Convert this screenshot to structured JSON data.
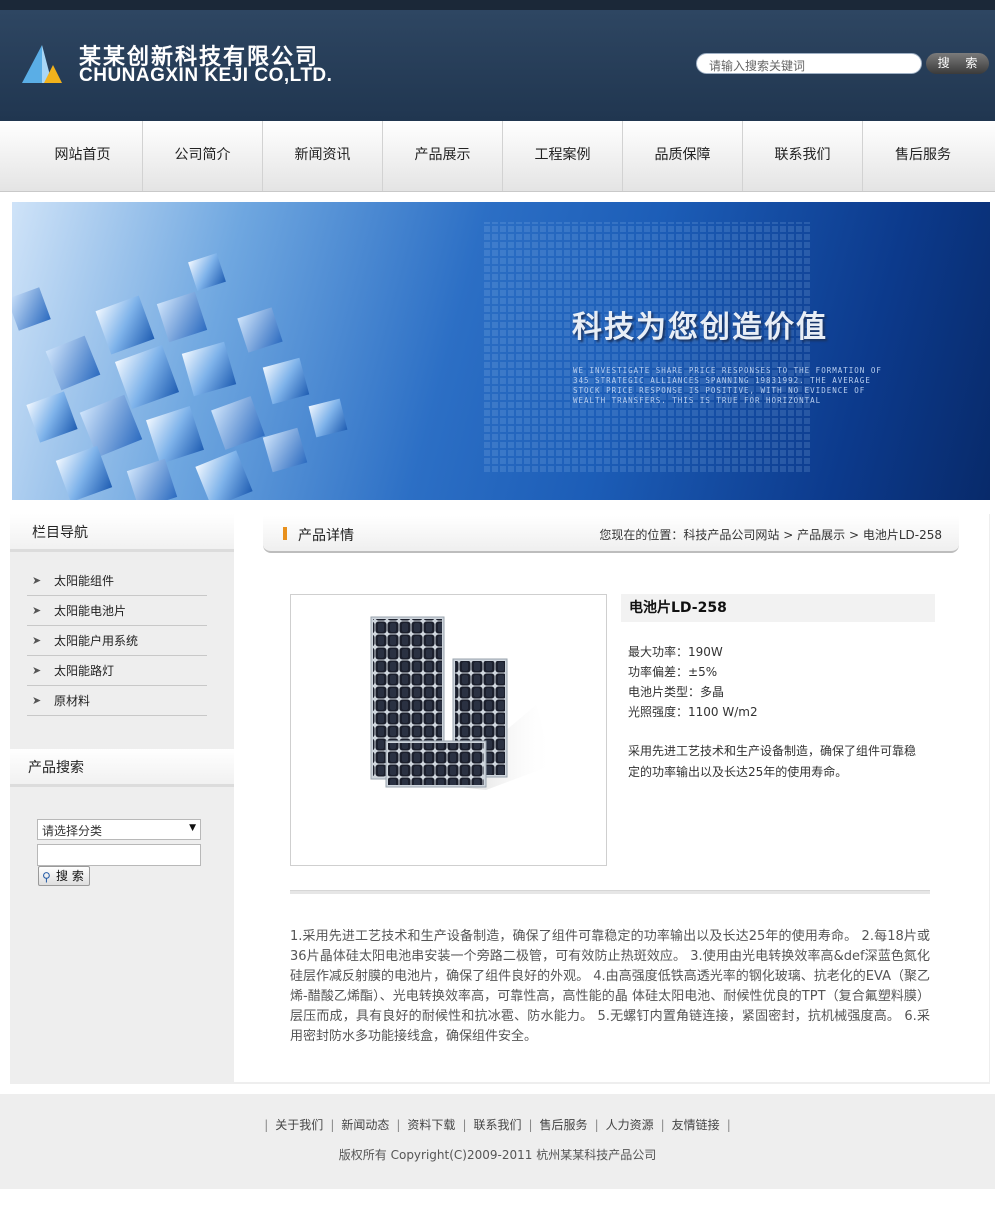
{
  "header": {
    "company_cn": "某某创新科技有限公司",
    "company_en": "CHUNAGXIN KEJI CO,LTD.",
    "search_placeholder": "请输入搜索关键词",
    "search_button": "搜 索"
  },
  "nav": {
    "items": [
      {
        "label": "网站首页"
      },
      {
        "label": "公司简介"
      },
      {
        "label": "新闻资讯"
      },
      {
        "label": "产品展示"
      },
      {
        "label": "工程案例"
      },
      {
        "label": "品质保障"
      },
      {
        "label": "联系我们"
      },
      {
        "label": "售后服务"
      }
    ]
  },
  "banner": {
    "title": "科技为您创造价值",
    "subtitle": "WE INVESTIGATE SHARE PRICE RESPONSES TO THE FORMATION OF 345 STRATEGIC ALLIANCES SPANNING 19831992. THE AVERAGE STOCK PRICE RESPONSE IS POSITIVE, WITH NO EVIDENCE OF WEALTH TRANSFERS. THIS IS TRUE FOR HORIZONTAL"
  },
  "sidebar": {
    "nav_title": "栏目导航",
    "items": [
      {
        "label": "太阳能组件"
      },
      {
        "label": "太阳能电池片"
      },
      {
        "label": "太阳能户用系统"
      },
      {
        "label": "太阳能路灯"
      },
      {
        "label": "原材料"
      }
    ],
    "search_title": "产品搜索",
    "category_selected": "请选择分类",
    "search_button": "搜 索"
  },
  "detail": {
    "section_title": "产品详情",
    "breadcrumb": {
      "prefix": "您现在的位置：",
      "home": "科技产品公司网站",
      "sep1": " > ",
      "category": "产品展示",
      "sep2": " > ",
      "current": "电池片LD-258"
    },
    "product_name": "电池片LD-258",
    "specs": [
      {
        "label": "最大功率：",
        "value": "190W"
      },
      {
        "label": "功率偏差：",
        "value": "±5%"
      },
      {
        "label": "电池片类型：",
        "value": "多晶"
      },
      {
        "label": "光照强度：",
        "value": "1100 W/m2"
      }
    ],
    "summary": "采用先进工艺技术和生产设备制造，确保了组件可靠稳定的功率输出以及长达25年的使用寿命。",
    "description": "1.采用先进工艺技术和生产设备制造，确保了组件可靠稳定的功率输出以及长达25年的使用寿命。  2.每18片或36片晶体硅太阳电池串安装一个旁路二极管，可有效防止热斑效应。  3.使用由光电转换效率高&def深蓝色氮化硅层作减反射膜的电池片，确保了组件良好的外观。  4.由高强度低铁高透光率的钢化玻璃、抗老化的EVA（聚乙烯-醋酸乙烯酯）、光电转换效率高，可靠性高，高性能的晶 体硅太阳电池、耐候性优良的TPT（复合氟塑料膜）层压而成，具有良好的耐候性和抗冰雹、防水能力。  5.无螺钉内置角链连接，紧固密封，抗机械强度高。  6.采用密封防水多功能接线盒，确保组件安全。"
  },
  "footer": {
    "links": [
      {
        "label": "关于我们"
      },
      {
        "label": "新闻动态"
      },
      {
        "label": "资料下载"
      },
      {
        "label": "联系我们"
      },
      {
        "label": "售后服务"
      },
      {
        "label": "人力资源"
      },
      {
        "label": "友情链接"
      }
    ],
    "separator": "|",
    "copyright": "版权所有  Copyright(C)2009-2011 杭州某某科技产品公司"
  }
}
